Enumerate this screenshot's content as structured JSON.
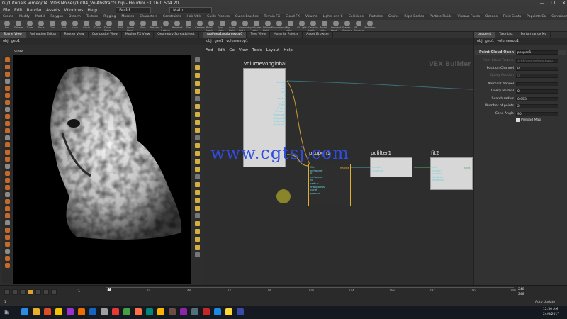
{
  "window": {
    "title": "G:/Tutorials Vimeo/04. VDB Noises/Tut04_VolAbstracts.hip - Houdini FX 16.0.504.20",
    "controls": [
      "—",
      "❐",
      "✕"
    ]
  },
  "menubar": {
    "items": [
      "File",
      "Edit",
      "Render",
      "Assets",
      "Windows",
      "Help"
    ],
    "desktop": "Build",
    "desktop2": "Main"
  },
  "shelf_tabs": [
    "Create",
    "Modify",
    "Model",
    "Polygon",
    "Deform",
    "Texture",
    "Rigging",
    "Muscles",
    "Characters",
    "Constraints",
    "Hair Utils",
    "Guide Process",
    "Guide Brushes",
    "Terrain FX",
    "Cloud FX",
    "Volume",
    "Lights and C",
    "Collisions",
    "Particles",
    "Grains",
    "Rigid Bodies",
    "Particle Fluids",
    "Viscous Fluids",
    "Oceans",
    "Fluid Conta",
    "Populate Co",
    "Container Tools",
    "Pyro FX",
    "FEM",
    "Wires",
    "Crowds",
    "Drive Simula"
  ],
  "shelf_tools": [
    "Box",
    "Sphere",
    "Tube",
    "Torus",
    "Grid",
    "Null",
    "Line",
    "Circle",
    "Curve",
    "Draw Curve",
    "Path",
    "Spray Paint",
    "Font",
    "Platonic",
    "L-System",
    "Metaball",
    "File",
    "Camera",
    "Point Light",
    "Spot Light",
    "Area Light",
    "Geometry Light",
    "Volume Light",
    "Distant Light",
    "Environment",
    "Sky Light",
    "GI Light",
    "Caustic Light",
    "Portal Light",
    "Ambient Light",
    "Stereo Camera",
    "VR Camera",
    "Switcher"
  ],
  "left_pane": {
    "tabs": [
      "Scene View",
      "Animation Editor",
      "Render View",
      "Composite View",
      "Motion FX View",
      "Geometry Spreadsheet"
    ],
    "path": [
      "obj",
      "geo1"
    ],
    "view_label": "View",
    "persp": "Ortho",
    "cam": "No cam"
  },
  "network_pane": {
    "tabs": [
      "/obj/geo1/volumevop1",
      "Tree View",
      "Material Palette",
      "Asset Browser"
    ],
    "path": [
      "obj",
      "geo1",
      "volumevop1"
    ],
    "menu": [
      "Add",
      "Edit",
      "Go",
      "View",
      "Tools",
      "Layout",
      "Help"
    ],
    "context_label": "VEX Builder",
    "nodes": {
      "global": {
        "name": "volumevopglobal1",
        "ports": [
          "density",
          "Cd",
          "vel",
          "vel",
          "P",
          "center",
          "Cd",
          "Time",
          "Frame",
          "TimeInc",
          "OpInput1",
          "OpInput2",
          "OpInput3",
          "OpInput4"
        ]
      },
      "pcopen": {
        "name": "pcopen1",
        "out": "handle",
        "ports": [
          "file",
          "pchannel",
          "P",
          "nchannel",
          "N",
          "radius",
          "maxpoints",
          "cone",
          "preload"
        ]
      },
      "pcfilter": {
        "name": "pcfilter1",
        "ports": [
          "handle",
          "channel"
        ]
      },
      "fit": {
        "name": "fit2",
        "out": "shift",
        "ports": [
          "val",
          "srcmin",
          "srcmax",
          "destmin",
          "destmax"
        ]
      }
    },
    "watermark": "www.cgtsj.com"
  },
  "param_pane": {
    "tabs": [
      "pcopen1",
      "Take List",
      "Performance Mo"
    ],
    "path": [
      "obj",
      "geo1",
      "volumevop1"
    ],
    "node_type": "Point Cloud Open",
    "node_name": "pcopen1",
    "rows": [
      {
        "label": "Point Cloud Texture",
        "value": "$HIP/geo/defgeo.bgeo",
        "dim": true
      },
      {
        "label": "Position Channel",
        "value": "P",
        "dim": false
      },
      {
        "label": "Query Position",
        "value": "0",
        "dim": true
      },
      {
        "label": "Normal Channel",
        "value": "",
        "dim": false
      },
      {
        "label": "Query Normal",
        "value": "0",
        "dim": false
      },
      {
        "label": "Search radius",
        "value": "0.053",
        "dim": false
      },
      {
        "label": "Number of points",
        "value": "2",
        "dim": false
      },
      {
        "label": "Cone Angle",
        "value": "90",
        "dim": false
      }
    ],
    "preload_label": "Preload Map"
  },
  "timeline": {
    "frame": "1",
    "start": "1",
    "end": "1",
    "ticks": [
      "1",
      "24",
      "48",
      "72",
      "96",
      "120",
      "144",
      "168",
      "192",
      "216",
      "240"
    ],
    "range_end": "248",
    "range_end2": "248",
    "auto_update": "Auto Update"
  },
  "taskbar": {
    "time": "12:50 AM",
    "date": "24/6/2017",
    "icon_colors": [
      "#2b8ce6",
      "#e8b02a",
      "#e04c2a",
      "#f2c200",
      "#9c2fd0",
      "#ef6c00",
      "#1565c0",
      "#9e9e9e",
      "#e53935",
      "#43a047",
      "#ff7043",
      "#00897b",
      "#ffb300",
      "#6d4c41",
      "#8e24aa",
      "#546e7a",
      "#c62828",
      "#1e88e5",
      "#fdd835",
      "#3949ab"
    ]
  }
}
